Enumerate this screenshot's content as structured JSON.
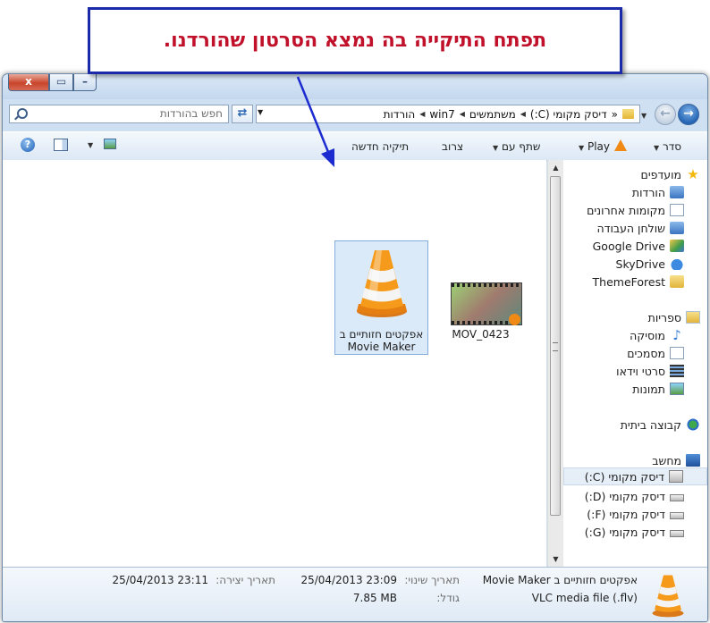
{
  "callout": {
    "text": "תפתח התיקייה בה נמצא הסרטון שהורדנו."
  },
  "titlebar": {
    "close": "x",
    "maximize": "▭",
    "minimize": "–"
  },
  "address": {
    "crumbs": [
      "דיסק מקומי (C:)",
      "משתמשים",
      "win7",
      "הורדות"
    ],
    "overflow": "«"
  },
  "search": {
    "placeholder": "חפש בהורדות"
  },
  "toolbar": {
    "organize": "סדר",
    "play": "Play",
    "share": "שתף עם",
    "burn": "צרוב",
    "new_folder": "תיקיה חדשה"
  },
  "files": [
    {
      "name": "אפקטים חזותיים ב Movie Maker",
      "type": "folder-vlc"
    },
    {
      "name": "MOV_0423",
      "type": "video"
    }
  ],
  "nav": {
    "favorites": {
      "label": "מועדפים",
      "icon": "star-icon",
      "items": [
        {
          "label": "הורדות",
          "icon": "downloads-folder-icon"
        },
        {
          "label": "מקומות אחרונים",
          "icon": "recent-places-icon"
        },
        {
          "label": "שולחן העבודה",
          "icon": "desktop-icon"
        },
        {
          "label": "Google Drive",
          "icon": "google-drive-icon"
        },
        {
          "label": "SkyDrive",
          "icon": "skydrive-icon"
        },
        {
          "label": "ThemeForest",
          "icon": "folder-icon"
        }
      ]
    },
    "libraries": {
      "label": "ספריות",
      "icon": "libraries-icon",
      "items": [
        {
          "label": "מוסיקה",
          "icon": "music-icon"
        },
        {
          "label": "מסמכים",
          "icon": "documents-icon"
        },
        {
          "label": "סרטי וידאו",
          "icon": "videos-icon"
        },
        {
          "label": "תמונות",
          "icon": "pictures-icon"
        }
      ]
    },
    "homegroup": {
      "label": "קבוצה ביתית",
      "icon": "homegroup-icon"
    },
    "computer": {
      "label": "מחשב",
      "icon": "computer-icon",
      "items": [
        {
          "label": "דיסק מקומי (C:)",
          "icon": "local-disk-icon"
        },
        {
          "label": "דיסק מקומי (D:)",
          "icon": "local-disk-icon"
        },
        {
          "label": "דיסק מקומי (F:)",
          "icon": "local-disk-icon"
        },
        {
          "label": "דיסק מקומי (G:)",
          "icon": "local-disk-icon"
        }
      ]
    }
  },
  "status": {
    "name": "אפקטים חזותיים ב Movie Maker",
    "type": "VLC media file (.flv)",
    "modified_label": "תאריך שינוי:",
    "modified_value": "25/04/2013 23:09",
    "created_label": "תאריך יצירה:",
    "created_value": "25/04/2013 23:11",
    "size_label": "גודל:",
    "size_value": "7.85 MB"
  },
  "colors": {
    "accent": "#1a2aa8",
    "callout_text": "#c0102a",
    "vlc": "#f08a14"
  }
}
